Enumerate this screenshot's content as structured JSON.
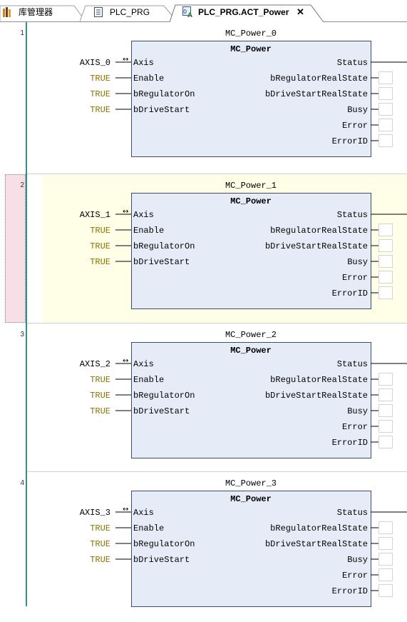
{
  "tabs": [
    {
      "label": "库管理器",
      "icon": "library-icon",
      "active": false
    },
    {
      "label": "PLC_PRG",
      "icon": "document-icon",
      "active": false
    },
    {
      "label": "PLC_PRG.ACT_Power",
      "icon": "action-icon",
      "active": true,
      "close": "✕"
    }
  ],
  "networks": [
    {
      "number": "1",
      "instance": "MC_Power_0",
      "type": "MC_Power",
      "axis": "AXIS_0",
      "selected": false,
      "inputs": [
        {
          "value": "AXIS_0",
          "pin": "Axis"
        },
        {
          "value": "TRUE",
          "pin": "Enable"
        },
        {
          "value": "TRUE",
          "pin": "bRegulatorOn"
        },
        {
          "value": "TRUE",
          "pin": "bDriveStart"
        }
      ],
      "outputs": [
        "Status",
        "bRegulatorRealState",
        "bDriveStartRealState",
        "Busy",
        "Error",
        "ErrorID"
      ]
    },
    {
      "number": "2",
      "instance": "MC_Power_1",
      "type": "MC_Power",
      "axis": "AXIS_1",
      "selected": true,
      "inputs": [
        {
          "value": "AXIS_1",
          "pin": "Axis"
        },
        {
          "value": "TRUE",
          "pin": "Enable"
        },
        {
          "value": "TRUE",
          "pin": "bRegulatorOn"
        },
        {
          "value": "TRUE",
          "pin": "bDriveStart"
        }
      ],
      "outputs": [
        "Status",
        "bRegulatorRealState",
        "bDriveStartRealState",
        "Busy",
        "Error",
        "ErrorID"
      ]
    },
    {
      "number": "3",
      "instance": "MC_Power_2",
      "type": "MC_Power",
      "axis": "AXIS_2",
      "selected": false,
      "inputs": [
        {
          "value": "AXIS_2",
          "pin": "Axis"
        },
        {
          "value": "TRUE",
          "pin": "Enable"
        },
        {
          "value": "TRUE",
          "pin": "bRegulatorOn"
        },
        {
          "value": "TRUE",
          "pin": "bDriveStart"
        }
      ],
      "outputs": [
        "Status",
        "bRegulatorRealState",
        "bDriveStartRealState",
        "Busy",
        "Error",
        "ErrorID"
      ]
    },
    {
      "number": "4",
      "instance": "MC_Power_3",
      "type": "MC_Power",
      "axis": "AXIS_3",
      "selected": false,
      "inputs": [
        {
          "value": "AXIS_3",
          "pin": "Axis"
        },
        {
          "value": "TRUE",
          "pin": "Enable"
        },
        {
          "value": "TRUE",
          "pin": "bRegulatorOn"
        },
        {
          "value": "TRUE",
          "pin": "bDriveStart"
        }
      ],
      "outputs": [
        "Status",
        "bRegulatorRealState",
        "bDriveStartRealState",
        "Busy",
        "Error",
        "ErrorID"
      ]
    }
  ],
  "colors": {
    "block_fill": "#e5ecf7",
    "block_border": "#3d4f66",
    "true_literal": "#8a7500",
    "selected_bg": "#ffffe7",
    "selected_marker": "#f8dfe5",
    "gutter_line": "#2f8f8f"
  }
}
